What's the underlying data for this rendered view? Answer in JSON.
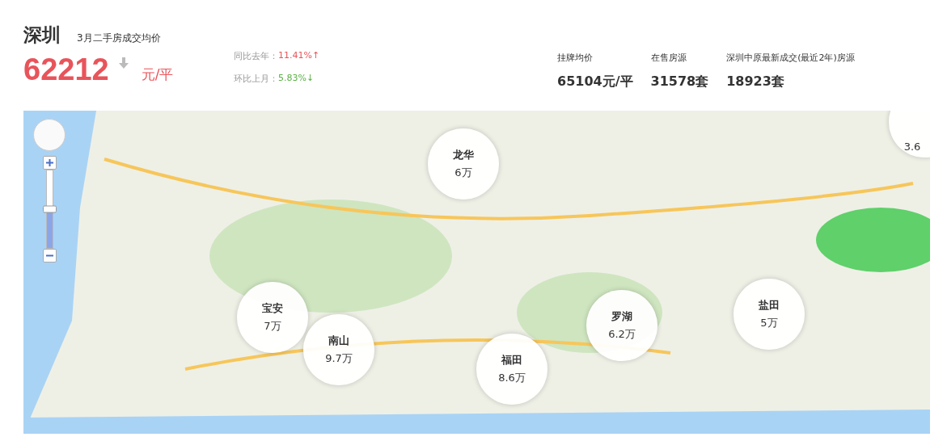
{
  "city": "深圳",
  "subtitle": "3月二手房成交均价",
  "price": {
    "value": "62212",
    "unit": "元/平"
  },
  "changes": [
    {
      "label": "同比去年：",
      "value": "11.41%↑",
      "rising": true
    },
    {
      "label": "环比上月：",
      "value": "5.83%↓",
      "rising": false
    }
  ],
  "stats": [
    {
      "label": "挂牌均价",
      "value": "65104元/平"
    },
    {
      "label": "在售房源",
      "value": "31578套"
    },
    {
      "label": "深圳中原最新成交(最近2年)房源",
      "value": "18923套"
    }
  ],
  "map": {
    "zoom": {
      "level": 0.5
    },
    "districts": [
      {
        "price": "3.6"
      },
      {
        "name": "龙华",
        "price": "6万"
      },
      {
        "name": "宝安",
        "price": "7万"
      },
      {
        "name": "南山",
        "price": "9.7万"
      },
      {
        "name": "福田",
        "price": "8.6万"
      },
      {
        "name": "罗湖",
        "price": "6.2万"
      },
      {
        "name": "盐田",
        "price": "5万"
      }
    ]
  }
}
